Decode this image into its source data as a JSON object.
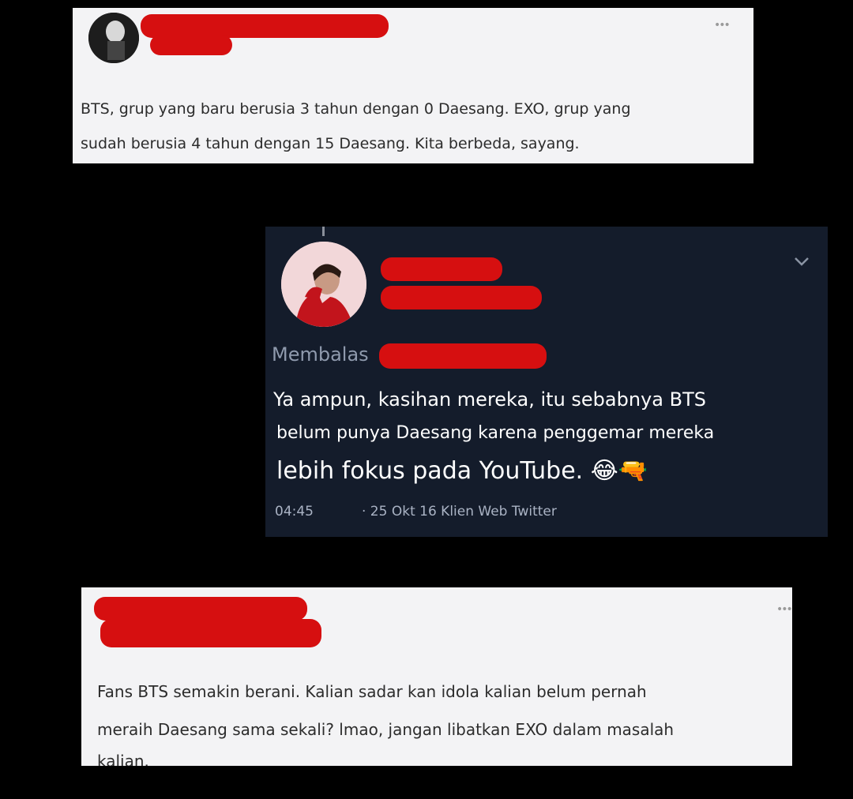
{
  "card1": {
    "lines": [
      "BTS, grup yang baru berusia 3 tahun dengan 0 Daesang. EXO, grup yang",
      "sudah berusia 4 tahun dengan 15 Daesang. Kita berbeda, sayang."
    ],
    "menu_icon": "more-dots-icon"
  },
  "card2": {
    "reply_label": "Membalas",
    "lines": [
      "Ya ampun, kasihan mereka, itu sebabnya BTS",
      "belum punya Daesang karena penggemar mereka"
    ],
    "big_line": "lebih fokus pada YouTube.",
    "emojis": [
      "😂",
      "🔫"
    ],
    "time": "04:45",
    "meta": "· 25 Okt 16 Klien Web Twitter",
    "menu_icon": "chevron-down-icon"
  },
  "card3": {
    "lines": [
      "Fans BTS semakin berani. Kalian sadar kan idola kalian belum pernah",
      "meraih Daesang sama sekali? lmao, jangan libatkan EXO dalam masalah",
      "kalian."
    ],
    "menu_icon": "more-dots-icon"
  },
  "colors": {
    "redaction": "#d60f10",
    "dark_card": "#141c2b",
    "light_card": "#f3f3f5"
  }
}
